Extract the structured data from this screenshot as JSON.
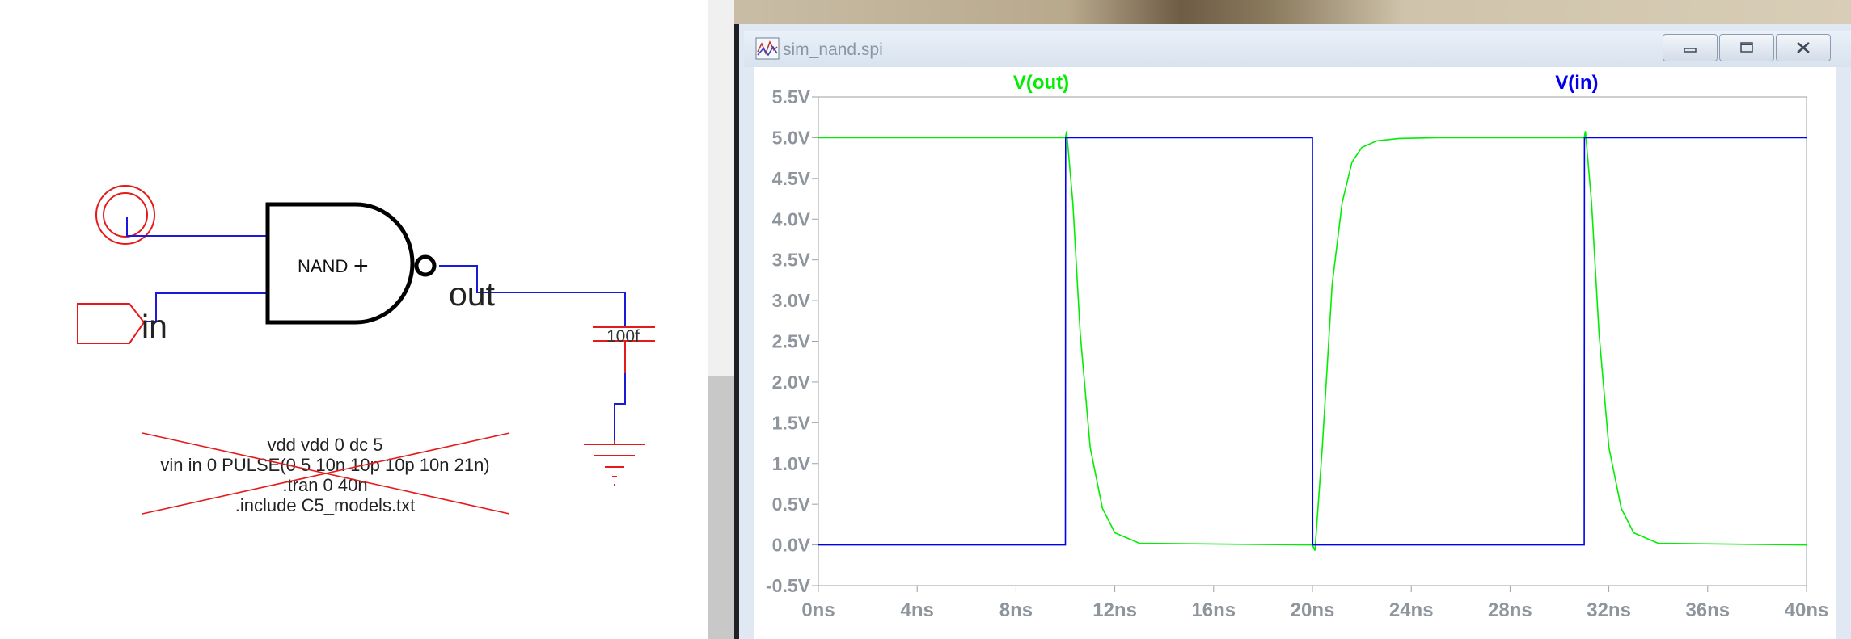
{
  "schematic": {
    "gate_label": "NAND",
    "gate_plus": "+",
    "in_label": "in",
    "out_label": "out",
    "cap_value": "100f",
    "directives": [
      "vdd vdd 0 dc 5",
      "vin in 0 PULSE(0 5 10n 10p 10p 10n 21n)",
      ".tran 0 40n",
      ".include C5_models.txt"
    ]
  },
  "window": {
    "title": "sim_nand.spi",
    "min_icon": "minimize-icon",
    "max_icon": "maximize-icon",
    "close_icon": "close-icon"
  },
  "chart_data": {
    "type": "line",
    "xlabel": "",
    "ylabel": "",
    "xlim": [
      0,
      40
    ],
    "ylim": [
      -0.5,
      5.5
    ],
    "x_ticks": [
      "0ns",
      "4ns",
      "8ns",
      "12ns",
      "16ns",
      "20ns",
      "24ns",
      "28ns",
      "32ns",
      "36ns",
      "40ns"
    ],
    "y_ticks": [
      "-0.5V",
      "0.0V",
      "0.5V",
      "1.0V",
      "1.5V",
      "2.0V",
      "2.5V",
      "3.0V",
      "3.5V",
      "4.0V",
      "4.5V",
      "5.0V",
      "5.5V"
    ],
    "legend_position": "top",
    "series": [
      {
        "name": "V(out)",
        "color": "#00ee00",
        "x": [
          0,
          10,
          10.05,
          10.3,
          10.6,
          11.0,
          11.5,
          12.0,
          13.0,
          20.0,
          20.1,
          20.4,
          20.8,
          21.2,
          21.6,
          22.0,
          22.6,
          23.5,
          25.0,
          31.0,
          31.05,
          31.3,
          31.6,
          32.0,
          32.5,
          33.0,
          34.0,
          40.0
        ],
        "y": [
          5.0,
          5.0,
          5.08,
          4.2,
          2.6,
          1.2,
          0.45,
          0.15,
          0.02,
          0.0,
          -0.07,
          1.2,
          3.2,
          4.2,
          4.7,
          4.88,
          4.96,
          4.99,
          5.0,
          5.0,
          5.08,
          4.2,
          2.6,
          1.2,
          0.45,
          0.15,
          0.02,
          0.0
        ]
      },
      {
        "name": "V(in)",
        "color": "#0000ee",
        "x": [
          0,
          10,
          10.01,
          20,
          20.01,
          31,
          31.01,
          40
        ],
        "y": [
          0,
          0,
          5,
          5,
          0,
          0,
          5,
          5
        ]
      }
    ]
  }
}
